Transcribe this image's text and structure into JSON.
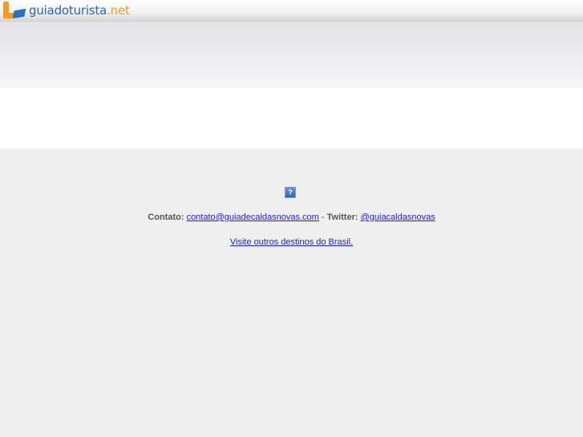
{
  "header": {
    "logo_main": "guiadoturista",
    "logo_suffix": ".net"
  },
  "footer": {
    "image_placeholder": "?",
    "contact_label": "Contato:",
    "contact_email": "contato@guiadecaldasnovas.com",
    "separator": " - ",
    "twitter_label": "Twitter:",
    "twitter_handle": "@guiacaldasnovas",
    "destinations_link": "Visite outros destinos do Brasil."
  },
  "colors": {
    "link": "#1a1aee",
    "logo_blue": "#2c63b3",
    "logo_orange": "#f39c1e"
  }
}
